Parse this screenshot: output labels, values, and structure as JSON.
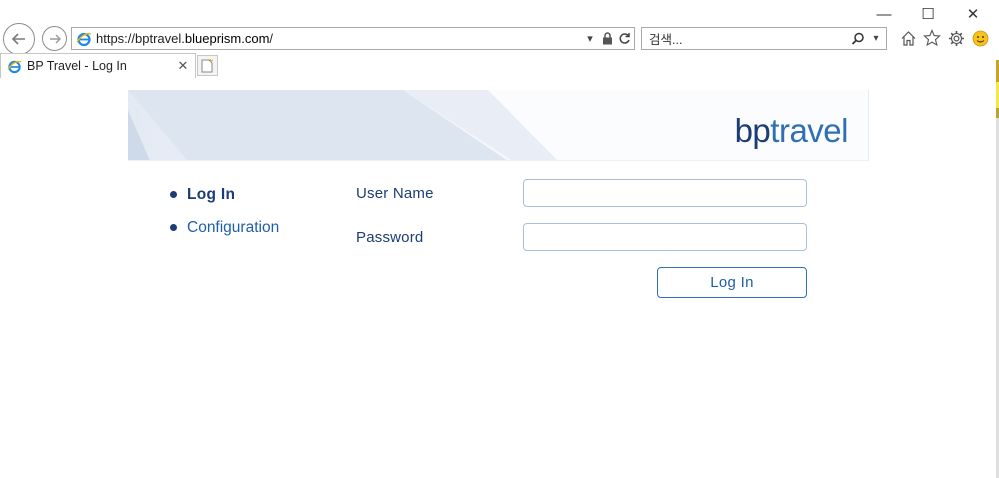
{
  "browser": {
    "address_scheme": "https://bptravel.",
    "address_host": "blueprism.com",
    "address_path": "/",
    "search_placeholder": "검색...",
    "tab_title": "BP Travel - Log In",
    "window_controls": {
      "minimize": "—",
      "maximize": "☐",
      "close": "✕"
    },
    "tab_close": "✕"
  },
  "page": {
    "logo_bp": "bp",
    "logo_travel": "travel",
    "nav": {
      "login": "Log In",
      "configuration": "Configuration"
    },
    "form": {
      "username_label": "User Name",
      "password_label": "Password",
      "username_value": "",
      "password_value": "",
      "login_button": "Log In"
    }
  },
  "colors": {
    "brand_dark": "#1b3c74",
    "brand_light": "#2f6fb3",
    "input_border": "#a9c0dc",
    "edge_strip": [
      "#c9a227",
      "#f2e84c",
      "#c9a227",
      "#3d3d3d"
    ]
  },
  "icons": [
    "back-arrow-icon",
    "forward-arrow-icon",
    "ie-logo-icon",
    "dropdown-icon",
    "lock-icon",
    "refresh-icon",
    "search-icon",
    "home-icon",
    "star-icon",
    "gear-icon",
    "smiley-icon",
    "new-tab-icon"
  ]
}
